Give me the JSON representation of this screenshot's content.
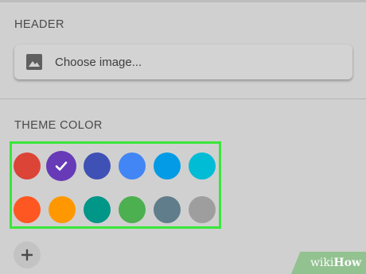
{
  "header_section": {
    "label": "HEADER",
    "choose_image_label": "Choose image...",
    "image_icon": "image-icon"
  },
  "theme_section": {
    "label": "THEME COLOR",
    "selected_index": 1,
    "colors": [
      {
        "hex": "#db4437"
      },
      {
        "hex": "#673ab7"
      },
      {
        "hex": "#3f51b5"
      },
      {
        "hex": "#4285f4"
      },
      {
        "hex": "#039be5"
      },
      {
        "hex": "#00bcd4"
      },
      {
        "hex": "#ff5722"
      },
      {
        "hex": "#ff9800"
      },
      {
        "hex": "#009688"
      },
      {
        "hex": "#4caf50"
      },
      {
        "hex": "#607d8b"
      },
      {
        "hex": "#9e9e9e"
      }
    ],
    "highlight_color": "#39e639",
    "add_icon": "plus-icon"
  },
  "watermark": {
    "wiki": "wiki",
    "how": "How"
  }
}
